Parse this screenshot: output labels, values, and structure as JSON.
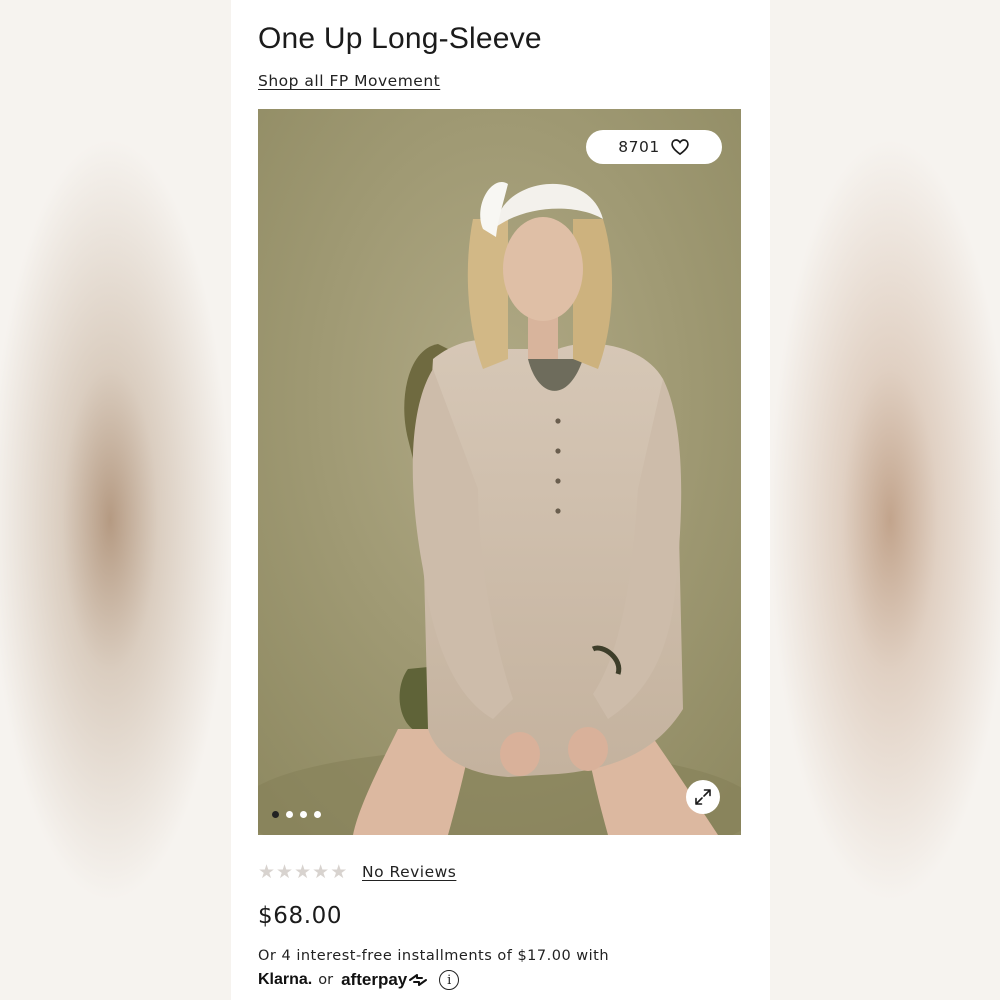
{
  "product": {
    "title": "One Up Long-Sleeve",
    "shop_link": "Shop all FP Movement",
    "favorites_count": "8701",
    "reviews_label": "No Reviews",
    "price": "$68.00",
    "rating_stars": [
      "★",
      "★",
      "★",
      "★",
      "★"
    ],
    "rating_value": 0
  },
  "gallery": {
    "image_count": 4,
    "active_index": 0
  },
  "payment": {
    "installments_text": "Or 4 interest-free installments of $17.00 with",
    "klarna_label": "Klarna.",
    "or_label": "or",
    "afterpay_label": "afterpay",
    "info_glyph": "i"
  },
  "icons": {
    "favorite": "heart-icon",
    "expand": "expand-arrows-icon",
    "afterpay_logo": "afterpay-arrows-icon",
    "info": "info-icon"
  },
  "colors": {
    "photo_background": "#a8a078",
    "text": "#1b1b1b",
    "star_empty": "#d8d3cf",
    "dot_active": "#222222"
  }
}
